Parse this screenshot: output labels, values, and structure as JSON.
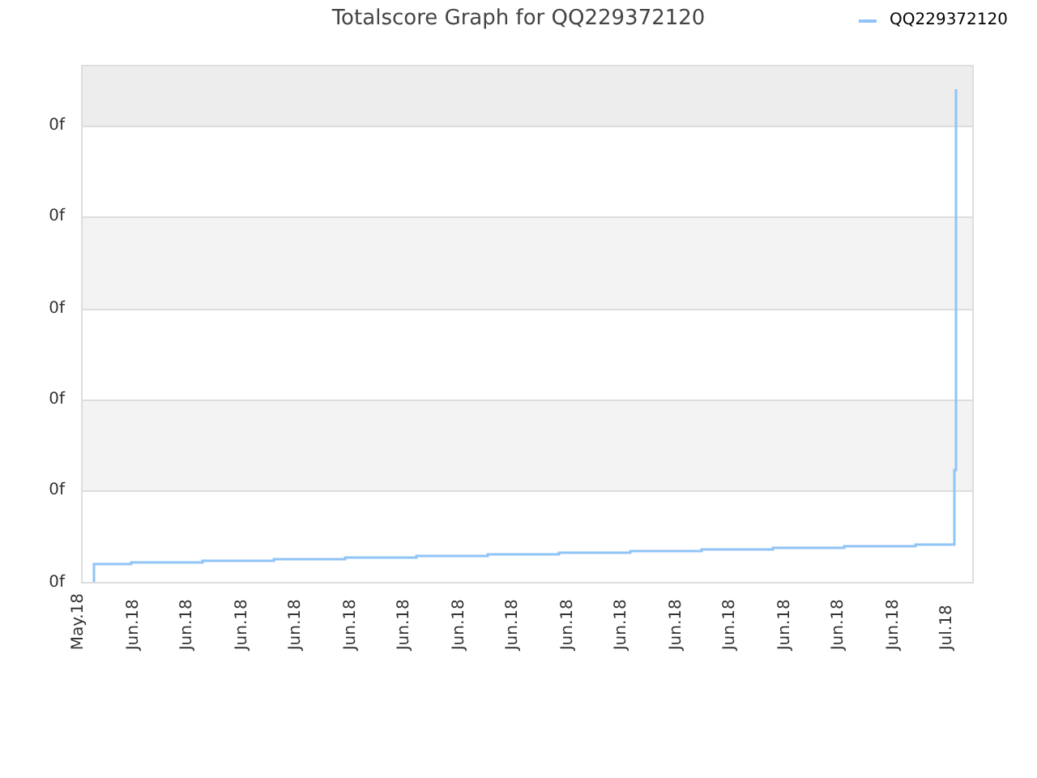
{
  "title": "Totalscore Graph for QQ229372120",
  "legend": [
    {
      "label": "QQ229372120",
      "color": "#90c4f5"
    }
  ],
  "y_ticks": [
    "0f",
    "0f",
    "0f",
    "0f",
    "0f",
    "0f"
  ],
  "x_ticks": [
    "May.18",
    "Jun.18",
    "Jun.18",
    "Jun.18",
    "Jun.18",
    "Jun.18",
    "Jun.18",
    "Jun.18",
    "Jun.18",
    "Jun.18",
    "Jun.18",
    "Jun.18",
    "Jun.18",
    "Jun.18",
    "Jun.18",
    "Jun.18",
    "Jul.18"
  ]
}
